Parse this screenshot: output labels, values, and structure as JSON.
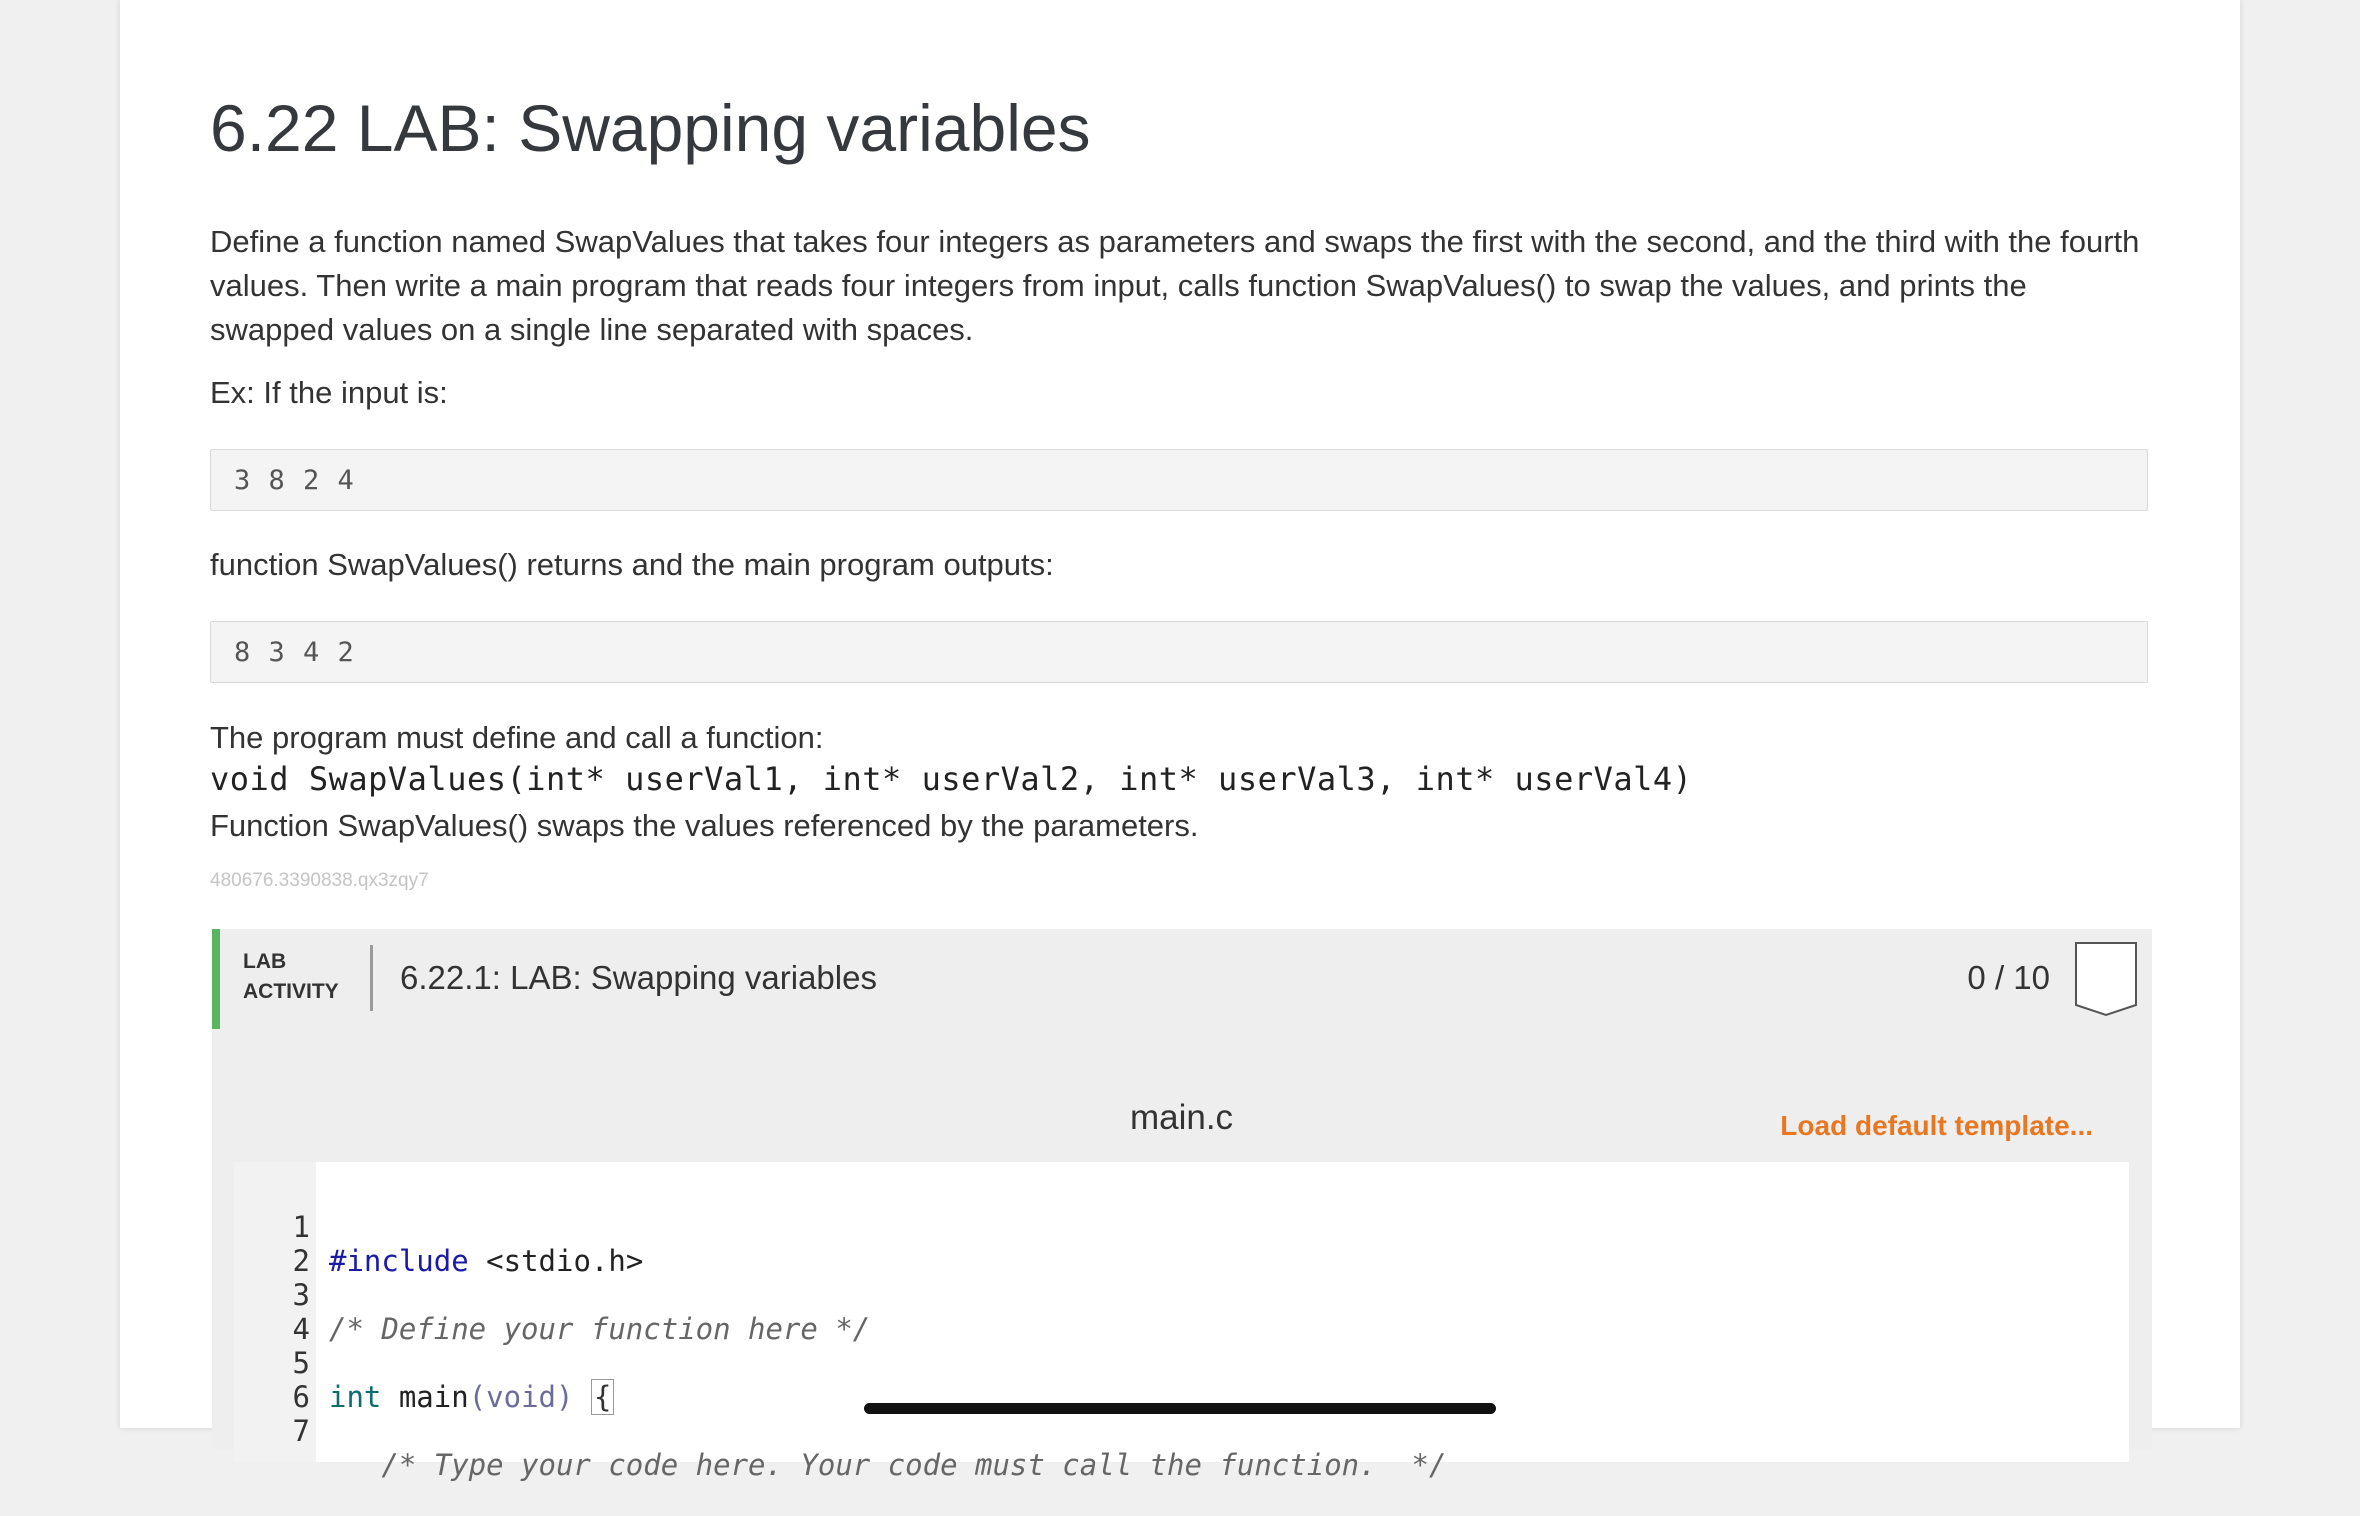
{
  "section_title": "6.22 LAB: Swapping variables",
  "description": "Define a function named SwapValues that takes four integers as parameters and swaps the first with the second, and the third with the fourth values. Then write a main program that reads four integers from input, calls function SwapValues() to swap the values, and prints the swapped values on a single line separated with spaces.",
  "example_intro": "Ex: If the input is:",
  "example_input": "3 8 2 4",
  "example_mid": "function SwapValues() returns and the main program outputs:",
  "example_output": "8 3 4 2",
  "requirement_intro": "The program must define and call a function:",
  "signature": "void SwapValues(int* userVal1, int* userVal2, int* userVal3, int* userVal4)",
  "requirement_note": "Function SwapValues() swaps the values referenced by the parameters.",
  "content_id": "480676.3390838.qx3zqy7",
  "lab": {
    "tag_line1": "LAB",
    "tag_line2": "ACTIVITY",
    "title": "6.22.1: LAB: Swapping variables",
    "score": "0 / 10",
    "accent_color": "#5bb55f"
  },
  "editor": {
    "filename": "main.c",
    "load_template": "Load default template...",
    "load_color": "#e87722",
    "lines": [
      {
        "n": "1",
        "a": "#include",
        "b": " <stdio.h>"
      },
      {
        "n": "2"
      },
      {
        "n": "3",
        "c": "/* Define your function here */"
      },
      {
        "n": "4"
      },
      {
        "n": "5",
        "t": "int",
        "m": " main",
        "p": "(void)",
        "s": " ",
        "br": "{"
      },
      {
        "n": "6"
      },
      {
        "n": "7",
        "c": "   /* Type your code here. Your code must call the function.  */"
      }
    ]
  }
}
